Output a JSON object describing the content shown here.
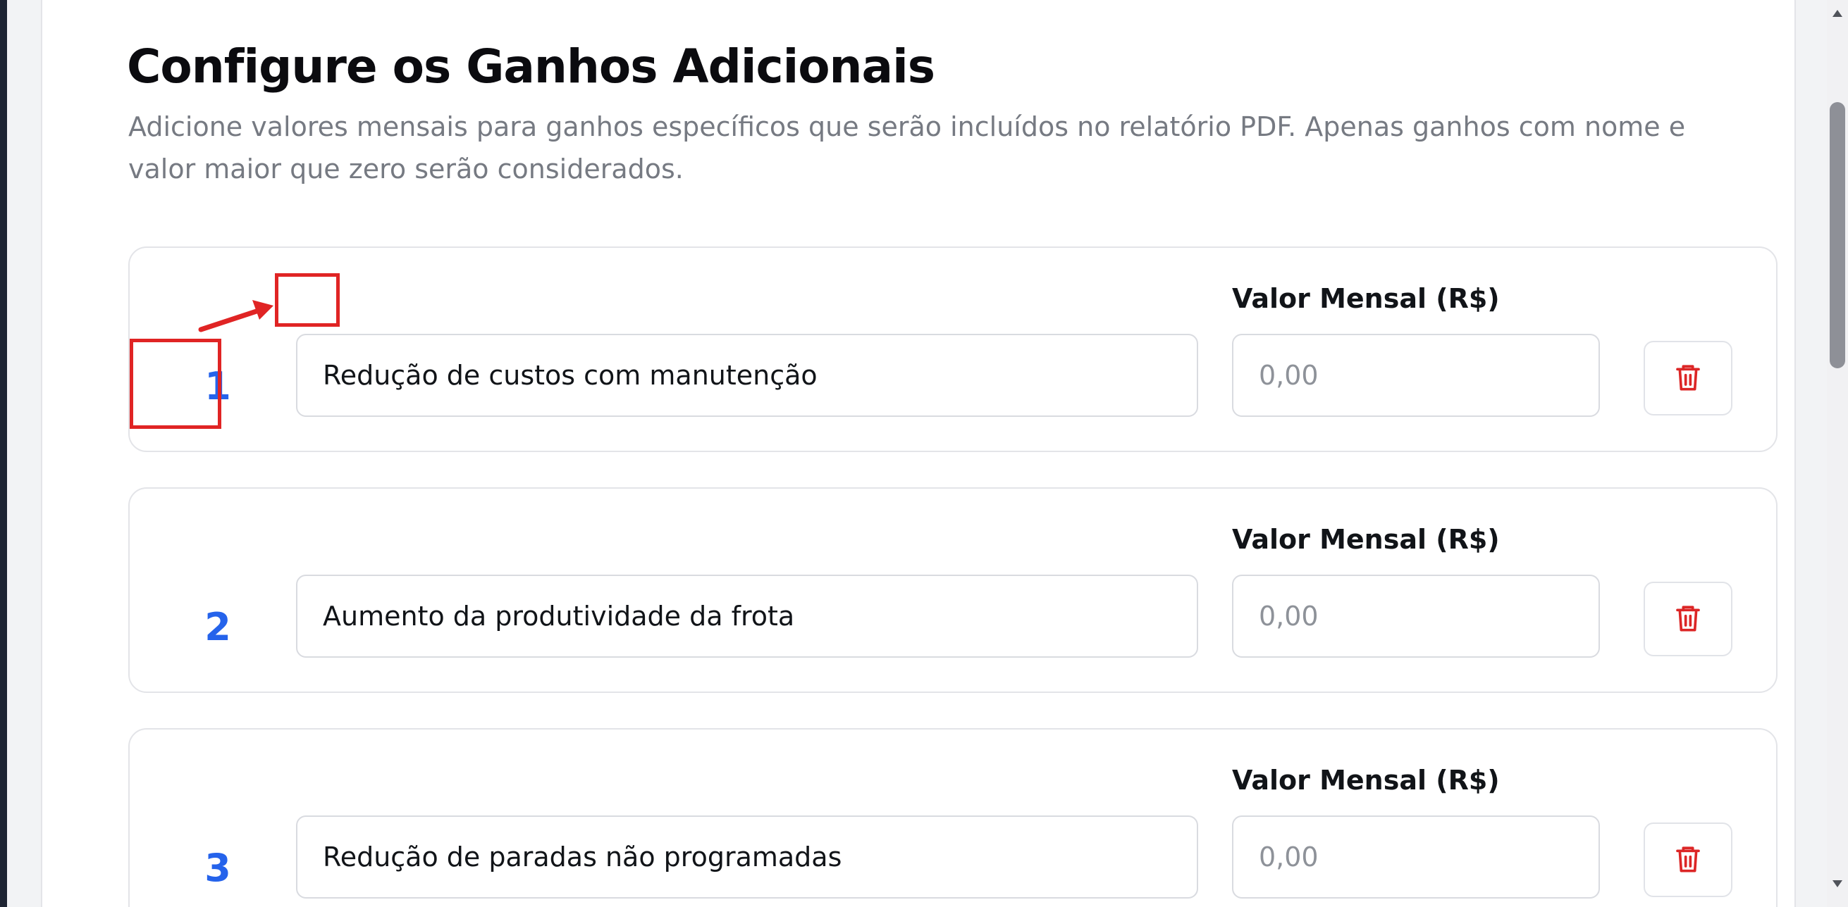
{
  "header": {
    "title": "Configure os Ganhos Adicionais",
    "description": "Adicione valores mensais para ganhos específicos que serão incluídos no relatório PDF. Apenas ganhos com nome e valor maior que zero serão considerados."
  },
  "gains": [
    {
      "number": "1",
      "name": "Redução de custos com manutenção",
      "value_label": "Valor Mensal (R$)",
      "value": "",
      "value_placeholder": "0,00",
      "delete_icon": "trash-icon"
    },
    {
      "number": "2",
      "name": "Aumento da produtividade da frota",
      "value_label": "Valor Mensal (R$)",
      "value": "",
      "value_placeholder": "0,00",
      "delete_icon": "trash-icon"
    },
    {
      "number": "3",
      "name": "Redução de paradas não programadas",
      "value_label": "Valor Mensal (R$)",
      "value": "",
      "value_placeholder": "0,00",
      "delete_icon": "trash-icon"
    }
  ],
  "colors": {
    "accent_number": "#2563eb",
    "delete_icon": "#dc2626",
    "annotation": "#e02424"
  },
  "scrollbar": {
    "up_icon": "arrow-up-icon",
    "down_icon": "arrow-down-icon"
  }
}
